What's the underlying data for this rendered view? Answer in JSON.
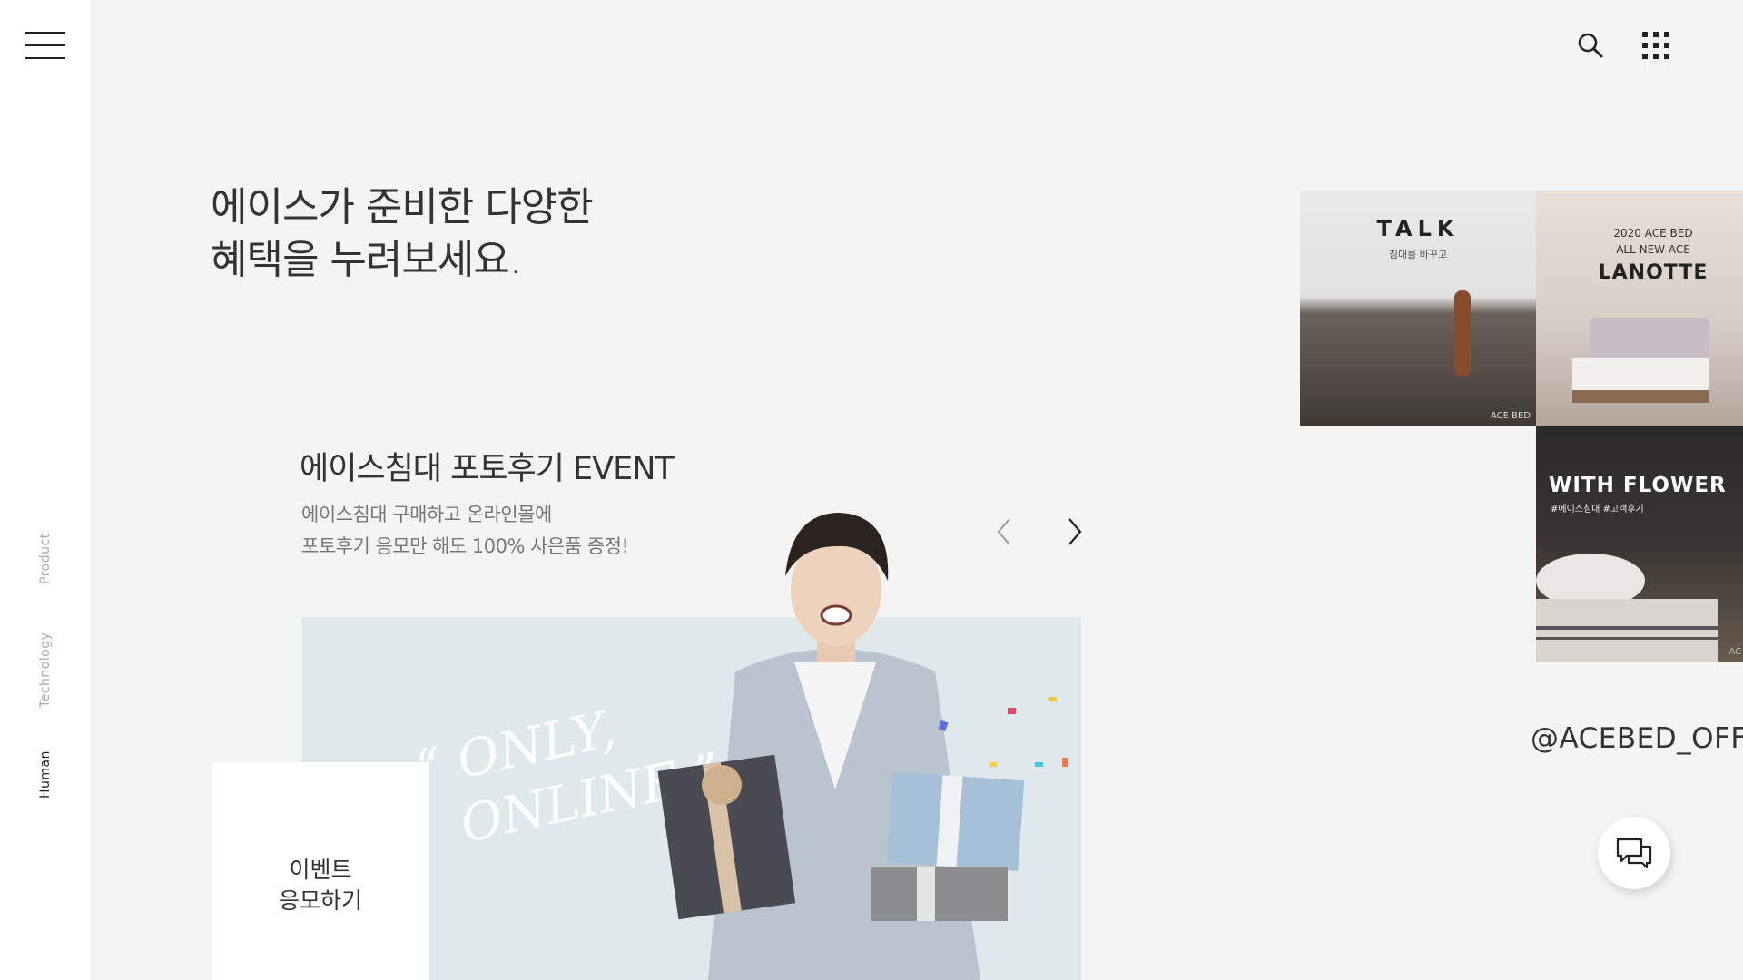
{
  "sidebar": {
    "nav": [
      {
        "label": "Product"
      },
      {
        "label": "Technology"
      },
      {
        "label": "Human"
      }
    ]
  },
  "header": {
    "icons": [
      "menu-icon",
      "search-icon",
      "grid-icon"
    ]
  },
  "hero": {
    "headline_line1": "에이스가 준비한 다양한",
    "headline_line2": "혜택을 누려보세요."
  },
  "event": {
    "title": "에이스침대 포토후기 EVENT",
    "desc_line1": "에이스침대 구매하고 온라인몰에",
    "desc_line2": "포토후기 응모만 해도 100% 사은품 증정!",
    "banner_script": "“ ONLY,\n  ONLINE ”",
    "cta_line1": "이벤트",
    "cta_line2": "응모하기"
  },
  "instagram": {
    "tiles": [
      {
        "title": "TALK",
        "subtitle": "침대를 바꾸고",
        "brand": "ACE BED"
      },
      {
        "line1": "2020 ACE BED",
        "line2": "ALL NEW ACE",
        "title": "LANOTTE"
      },
      {
        "title": "WITH FLOWER",
        "tags": "#에이스침대 #고객후기",
        "brand": "AC"
      }
    ],
    "handle": "@ACEBED_OFFIC"
  },
  "colors": {
    "background": "#f4f4f4",
    "sidebar": "#ffffff",
    "banner": "#dfe9ec",
    "text_dark": "#333333",
    "text_muted": "#777777"
  }
}
